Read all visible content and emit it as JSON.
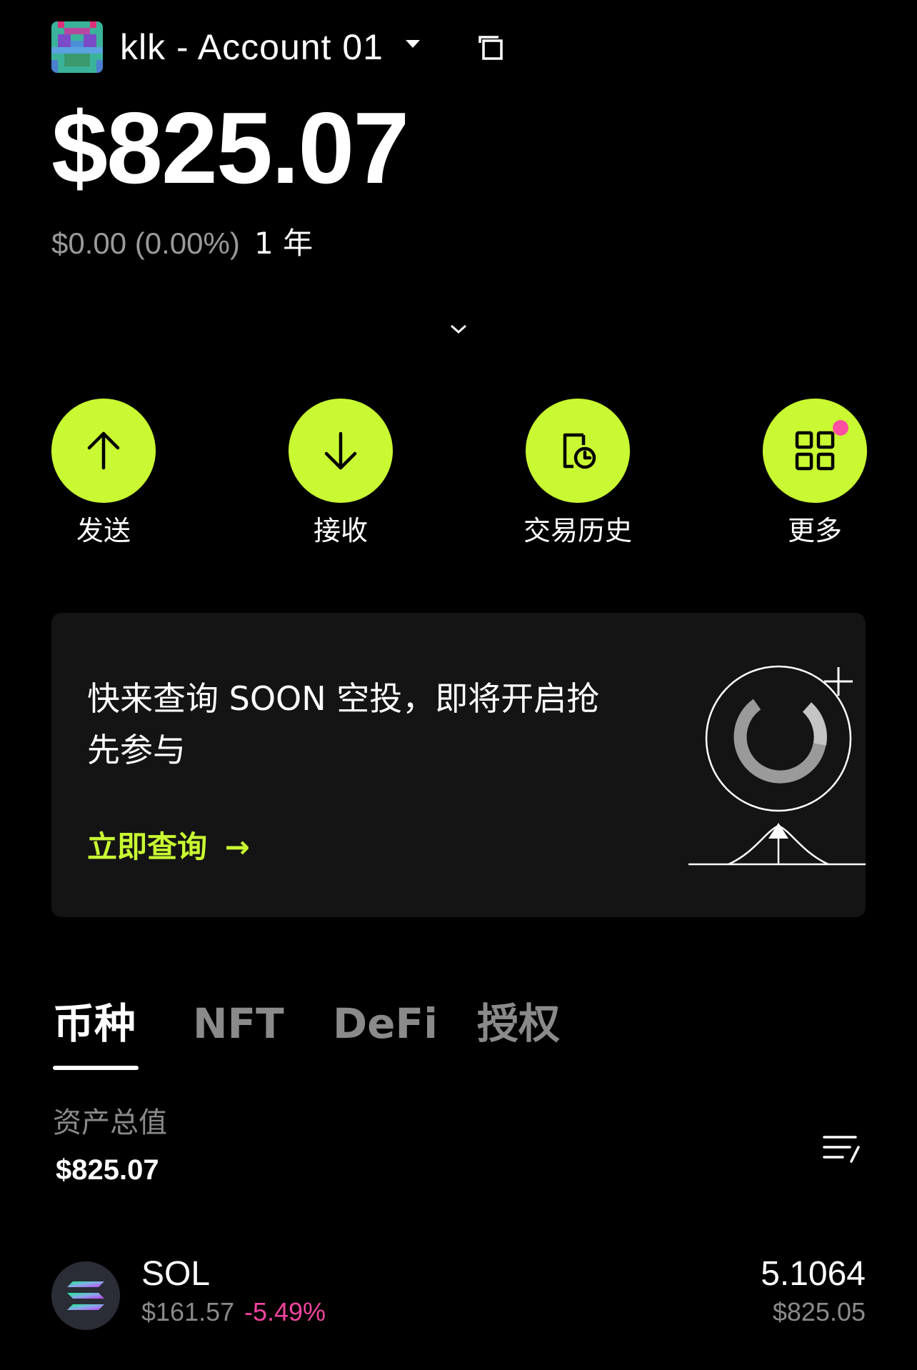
{
  "header": {
    "account_name": "klk - Account 01",
    "balance": "$825.07",
    "change": "$0.00 (0.00%)",
    "period": "1 年"
  },
  "actions": [
    {
      "label": "发送",
      "icon": "arrow-up-icon"
    },
    {
      "label": "接收",
      "icon": "arrow-down-icon"
    },
    {
      "label": "交易历史",
      "icon": "history-icon"
    },
    {
      "label": "更多",
      "icon": "grid-icon"
    }
  ],
  "banner": {
    "text": "快来查询 SOON 空投，即将开启抢先参与",
    "link_label": "立即查询",
    "link_arrow": "→"
  },
  "tabs": [
    "币种",
    "NFT",
    "DeFi",
    "授权"
  ],
  "assets": {
    "label": "资产总值",
    "total": "$825.07"
  },
  "tokens": [
    {
      "symbol": "SOL",
      "price": "$161.57",
      "change": "-5.49%",
      "amount": "5.1064",
      "value": "$825.05"
    }
  ],
  "colors": {
    "accent": "#c9f932",
    "negative": "#f2449f",
    "badge": "#ff4fa0",
    "muted": "#8a8a8a"
  }
}
